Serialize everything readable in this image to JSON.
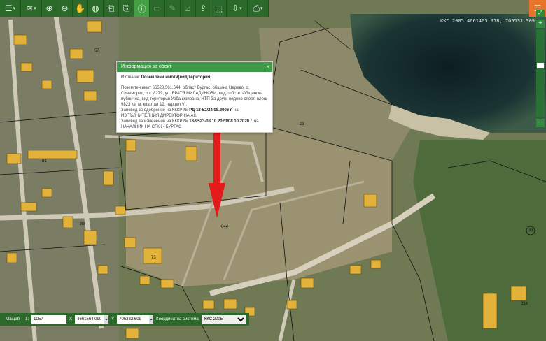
{
  "toolbar": {
    "tools": [
      {
        "name": "layers-toggle-icon",
        "glyph": "☰"
      },
      {
        "name": "layers-icon",
        "glyph": "≋"
      },
      {
        "name": "zoom-in-icon",
        "glyph": "⊕"
      },
      {
        "name": "zoom-out-icon",
        "glyph": "⊖"
      },
      {
        "name": "pan-hand-icon",
        "glyph": "✋"
      },
      {
        "name": "globe-icon",
        "glyph": "◍"
      },
      {
        "name": "prev-extent-icon",
        "glyph": "⎗"
      },
      {
        "name": "next-extent-icon",
        "glyph": "⎘"
      },
      {
        "name": "identify-info-icon",
        "glyph": "ⓘ"
      },
      {
        "name": "measure-distance-icon",
        "glyph": "▭"
      },
      {
        "name": "measure-ruler-icon",
        "glyph": "✎"
      },
      {
        "name": "measure-area-icon",
        "glyph": "⊿"
      },
      {
        "name": "upload-icon",
        "glyph": "⇪"
      },
      {
        "name": "select-region-icon",
        "glyph": "⬚"
      },
      {
        "name": "download-icon",
        "glyph": "⇩"
      },
      {
        "name": "print-icon",
        "glyph": "⎙"
      }
    ],
    "menu_glyph": "☰"
  },
  "map": {
    "coordinate_readout": "ККС 2005 4661405.978, 705531.309",
    "zoom_in": "+",
    "zoom_out": "−",
    "expand": "⤢",
    "parcel_labels": [
      "644",
      "73",
      "57",
      "89",
      "81",
      "23",
      "33",
      "234"
    ]
  },
  "popup": {
    "title": "Информация за обект",
    "close": "×",
    "source_label": "Източник:",
    "source_value": "Поземлени имоти(вид територия)",
    "desc_main": "Поземлен имот 66528.501.644, област Бургас, община Царево, с. Синеморец, п.к. 8279, ул. БРАТЯ МИЛАДИНОВИ, вид собств. Общинска публична, вид територия Урбанизирана, НТП За други видове спорт, площ 9823 кв. м, квартал 12, парцел VI,",
    "order1_pre": "Заповед за одобрение на КККР №",
    "order1_num": "РД-18-52/24.08.2006 г.",
    "order1_post": " на ИЗПЪЛНИТЕЛНИЯ ДИРЕКТОР НА АК,",
    "order2_pre": "Заповед за изменение на КККР №",
    "order2_num": "18-9523-08.10.2020/08.10.2020 г.",
    "order2_post": " на НАЧАЛНИК НА СГКК - БУРГАС"
  },
  "coordbar": {
    "scale_label": "Мащаб",
    "scale_prefix": "1:",
    "scale_value": "1057",
    "x_label": "X",
    "x_value": "4661564.090",
    "y_label": "Y",
    "y_value": "705282.609",
    "crs_label": "Координатна система",
    "crs_value": "ККС 2005"
  },
  "colors": {
    "toolbar": "#2b6a2b",
    "accent": "#3f9a49",
    "menu": "#e8732a",
    "arrow": "#e31b1b",
    "building": "#e2b23a"
  }
}
